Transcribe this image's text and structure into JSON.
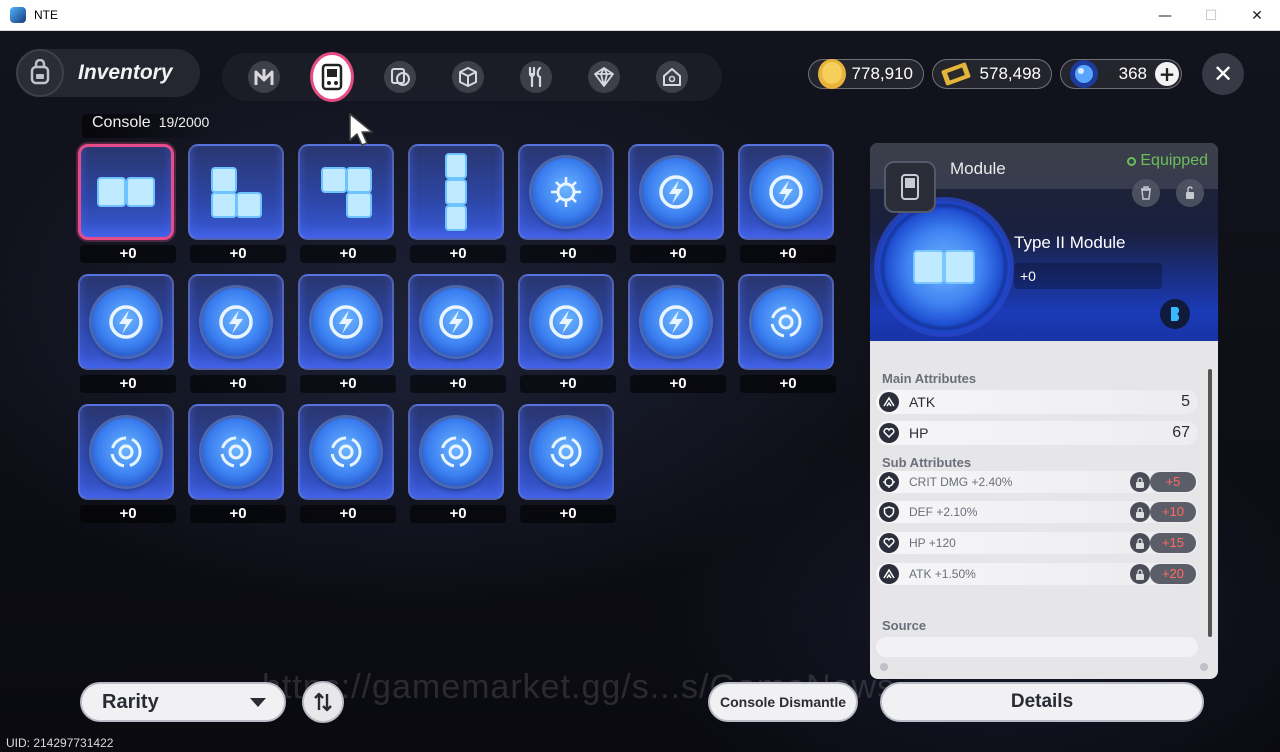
{
  "window": {
    "title": "NTE",
    "controls": {
      "minimize": "—",
      "maximize": "☐",
      "close": "✕"
    }
  },
  "header": {
    "inventory_label": "Inventory",
    "tabs": [
      {
        "icon": "n-logo-icon",
        "active": false
      },
      {
        "icon": "console-icon",
        "active": true
      },
      {
        "icon": "disc-card-icon",
        "active": false
      },
      {
        "icon": "box-icon",
        "active": false
      },
      {
        "icon": "fork-knife-icon",
        "active": false
      },
      {
        "icon": "cube-outline-icon",
        "active": false
      },
      {
        "icon": "home-icon",
        "active": false
      }
    ]
  },
  "currencies": [
    {
      "name": "gold-coin-icon",
      "value": "778,910"
    },
    {
      "name": "ticket-icon",
      "value": "578,498"
    },
    {
      "name": "crystal-icon",
      "value": "368"
    }
  ],
  "close_label": "✕",
  "plus_label": "+",
  "console": {
    "title": "Console",
    "count": "19/2000"
  },
  "items": [
    {
      "kind": "double-block",
      "level": "+0",
      "selected": true
    },
    {
      "kind": "l-block",
      "level": "+0"
    },
    {
      "kind": "j-block",
      "level": "+0"
    },
    {
      "kind": "i-block",
      "level": "+0"
    },
    {
      "kind": "compass-disc",
      "level": "+0"
    },
    {
      "kind": "bolt-disc",
      "level": "+0"
    },
    {
      "kind": "bolt-disc",
      "level": "+0"
    },
    {
      "kind": "bolt-disc",
      "level": "+0"
    },
    {
      "kind": "bolt-disc",
      "level": "+0"
    },
    {
      "kind": "bolt-disc",
      "level": "+0"
    },
    {
      "kind": "bolt-disc",
      "level": "+0"
    },
    {
      "kind": "bolt-disc",
      "level": "+0"
    },
    {
      "kind": "bolt-disc",
      "level": "+0"
    },
    {
      "kind": "ring-disc",
      "level": "+0"
    },
    {
      "kind": "ring-disc",
      "level": "+0"
    },
    {
      "kind": "ring-disc",
      "level": "+0"
    },
    {
      "kind": "ring-disc",
      "level": "+0"
    },
    {
      "kind": "ring-disc",
      "level": "+0"
    },
    {
      "kind": "ring-disc",
      "level": "+0"
    }
  ],
  "detail": {
    "category": "Module",
    "status": "Equipped",
    "name": "Type II Module",
    "level": "+0",
    "main_title": "Main Attributes",
    "main": [
      {
        "icon": "atk-icon",
        "name": "ATK",
        "value": "5"
      },
      {
        "icon": "hp-icon",
        "name": "HP",
        "value": "67"
      }
    ],
    "sub_title": "Sub Attributes",
    "sub": [
      {
        "icon": "crit-icon",
        "name": "CRIT DMG +2.40%",
        "roll": "+5"
      },
      {
        "icon": "def-icon",
        "name": "DEF +2.10%",
        "roll": "+10"
      },
      {
        "icon": "hp-icon",
        "name": "HP +120",
        "roll": "+15"
      },
      {
        "icon": "atk-icon",
        "name": "ATK +1.50%",
        "roll": "+20"
      }
    ],
    "source_title": "Source",
    "rank_icon": "rank-b-icon"
  },
  "footer": {
    "rarity": "Rarity",
    "dismantle": "Console Dismantle",
    "details": "Details",
    "watermark": "https://gamemarket.gg/s...s/GameNews",
    "uid": "UID: 214297731422"
  }
}
